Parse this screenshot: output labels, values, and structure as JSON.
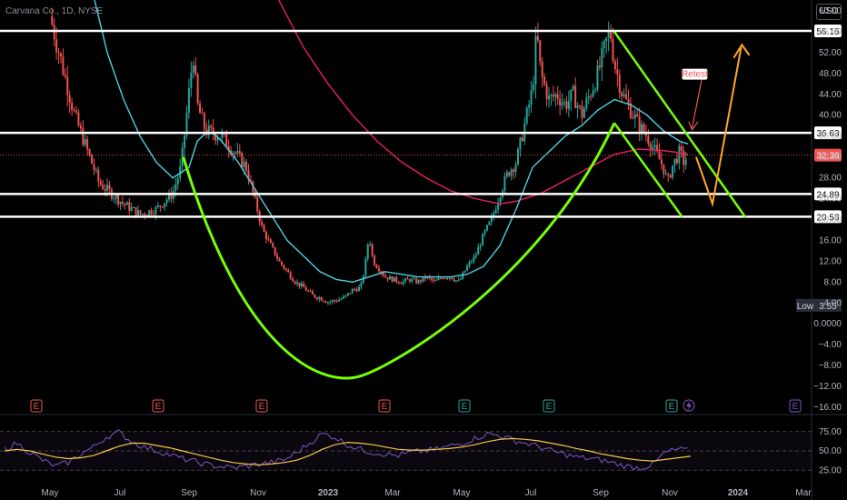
{
  "header": {
    "title": "Carvana Co., 1D, NYSE",
    "currency": "USD"
  },
  "colors": {
    "background": "#000000",
    "up": "#26a69a",
    "down": "#ef5350",
    "hline": "#ffffff",
    "ma_fast": "#4dd0e1",
    "ma_slow": "#e91e63",
    "pattern": "#76ff03",
    "projection": "#ffa726",
    "retest": "#ef5350",
    "rsi": "#7e57c2",
    "rsi_ma": "#f5c542"
  },
  "chart_data": {
    "type": "candlestick",
    "price_axis": {
      "ticks": [
        "60.00",
        "56.00",
        "52.00",
        "48.00",
        "44.00",
        "40.00",
        "36.00",
        "32.00",
        "28.00",
        "24.00",
        "20.00",
        "16.00",
        "12.00",
        "8.00",
        "4.00",
        "0.0000",
        "−4.00",
        "−8.00",
        "−12.00",
        "−16.00"
      ],
      "range": [
        -16,
        60
      ]
    },
    "time_axis": [
      "May",
      "Jul",
      "Sep",
      "Nov",
      "2023",
      "Mar",
      "May",
      "Jul",
      "Sep",
      "Nov",
      "2024",
      "Mar"
    ],
    "horizontal_levels": [
      {
        "value": 56.16,
        "label": "56.16"
      },
      {
        "value": 36.63,
        "label": "36.63"
      },
      {
        "value": 24.89,
        "label": "24.89"
      },
      {
        "value": 20.53,
        "label": "20.53"
      }
    ],
    "current_price": {
      "value": 32.36,
      "label": "32.36"
    },
    "low_marker": {
      "label": "Low",
      "value": "3.55"
    },
    "annotation": "Retest",
    "earnings_markers": [
      {
        "date": "2022-05-05",
        "type": "E",
        "color": "#ef5350"
      },
      {
        "date": "2022-08-04",
        "type": "E",
        "color": "#ef5350"
      },
      {
        "date": "2022-11-03",
        "type": "E",
        "color": "#ef5350"
      },
      {
        "date": "2023-02-23",
        "type": "E",
        "color": "#ef5350"
      },
      {
        "date": "2023-05-04",
        "type": "E",
        "color": "#26a69a"
      },
      {
        "date": "2023-07-19",
        "type": "E",
        "color": "#26a69a"
      },
      {
        "date": "2023-11-01",
        "type": "E",
        "color": "#26a69a"
      },
      {
        "date": "2024-02-22",
        "type": "E",
        "color": "#7e57c2"
      }
    ],
    "price_path": [
      [
        0,
        59
      ],
      [
        3,
        40
      ],
      [
        6,
        27
      ],
      [
        9,
        23
      ],
      [
        11,
        21
      ],
      [
        13,
        22
      ],
      [
        15,
        25
      ],
      [
        16,
        30
      ],
      [
        16.5,
        37
      ],
      [
        17.5,
        52
      ],
      [
        18,
        42
      ],
      [
        19,
        37
      ],
      [
        21,
        36
      ],
      [
        23,
        32
      ],
      [
        24,
        30
      ],
      [
        25,
        24
      ],
      [
        26,
        18
      ],
      [
        27,
        15
      ],
      [
        28,
        12
      ],
      [
        29,
        10
      ],
      [
        30,
        8
      ],
      [
        31,
        7
      ],
      [
        32,
        5.5
      ],
      [
        33,
        5
      ],
      [
        34,
        4.2
      ],
      [
        35,
        4.5
      ],
      [
        36,
        5
      ],
      [
        37,
        6.5
      ],
      [
        38,
        7
      ],
      [
        38.5,
        11
      ],
      [
        39,
        17
      ],
      [
        39.5,
        12
      ],
      [
        40,
        11
      ],
      [
        41,
        9
      ],
      [
        42,
        8.5
      ],
      [
        43,
        8
      ],
      [
        44,
        8.5
      ],
      [
        45,
        8
      ],
      [
        46,
        9
      ],
      [
        47,
        8
      ],
      [
        48,
        9
      ],
      [
        49,
        9
      ],
      [
        50,
        8
      ],
      [
        51,
        11
      ],
      [
        52,
        13
      ],
      [
        53,
        17
      ],
      [
        54,
        20
      ],
      [
        55,
        25
      ],
      [
        56,
        29
      ],
      [
        57,
        31
      ],
      [
        58,
        38
      ],
      [
        59,
        45
      ],
      [
        59.5,
        56
      ],
      [
        60,
        48
      ],
      [
        61,
        43
      ],
      [
        62,
        44
      ],
      [
        63,
        42
      ],
      [
        64,
        44
      ],
      [
        65,
        40
      ],
      [
        66,
        44
      ],
      [
        67,
        48
      ],
      [
        68,
        54
      ],
      [
        68.5,
        56
      ],
      [
        69,
        50
      ],
      [
        70,
        44
      ],
      [
        71,
        41
      ],
      [
        72,
        38
      ],
      [
        73,
        36
      ],
      [
        74,
        33
      ],
      [
        75,
        30
      ],
      [
        75.5,
        27
      ],
      [
        76,
        30
      ],
      [
        77,
        33
      ],
      [
        77.5,
        31
      ],
      [
        78,
        32.4
      ]
    ],
    "ma_fast_path": [
      [
        3,
        85
      ],
      [
        5,
        65
      ],
      [
        7,
        52
      ],
      [
        9,
        43
      ],
      [
        11,
        36
      ],
      [
        13,
        31
      ],
      [
        15,
        28
      ],
      [
        17,
        30
      ],
      [
        18,
        35
      ],
      [
        19,
        36.5
      ],
      [
        20,
        36.5
      ],
      [
        21,
        35
      ],
      [
        23,
        31
      ],
      [
        25,
        26
      ],
      [
        27,
        21
      ],
      [
        29,
        16
      ],
      [
        31,
        13
      ],
      [
        33,
        10
      ],
      [
        35,
        8.5
      ],
      [
        37,
        8
      ],
      [
        39,
        9
      ],
      [
        41,
        10
      ],
      [
        43,
        9.5
      ],
      [
        45,
        9
      ],
      [
        47,
        9
      ],
      [
        49,
        9
      ],
      [
        51,
        9.5
      ],
      [
        53,
        11
      ],
      [
        55,
        15
      ],
      [
        57,
        22
      ],
      [
        59,
        30
      ],
      [
        61,
        33
      ],
      [
        63,
        36
      ],
      [
        65,
        38
      ],
      [
        67,
        41
      ],
      [
        69,
        43
      ],
      [
        71,
        42
      ],
      [
        73,
        40
      ],
      [
        75,
        37
      ],
      [
        77,
        35
      ],
      [
        78,
        34.5
      ]
    ],
    "ma_slow_path": [
      [
        20,
        100
      ],
      [
        22,
        88
      ],
      [
        25,
        73
      ],
      [
        28,
        62
      ],
      [
        31,
        53
      ],
      [
        34,
        46
      ],
      [
        37,
        40
      ],
      [
        40,
        35
      ],
      [
        43,
        31
      ],
      [
        46,
        28
      ],
      [
        49,
        25.5
      ],
      [
        52,
        24
      ],
      [
        55,
        23
      ],
      [
        57,
        23.5
      ],
      [
        60,
        25
      ],
      [
        63,
        27.5
      ],
      [
        66,
        30
      ],
      [
        69,
        32.5
      ],
      [
        72,
        33.5
      ],
      [
        75,
        33.2
      ],
      [
        77,
        32.8
      ],
      [
        78,
        32.5
      ]
    ],
    "rsi": {
      "levels": [
        "75.00",
        "50.00",
        "25.00"
      ],
      "range": [
        10,
        90
      ],
      "values": [
        52,
        60,
        48,
        38,
        30,
        35,
        46,
        55,
        68,
        74,
        62,
        55,
        50,
        45,
        40,
        36,
        32,
        30,
        28,
        30,
        33,
        35,
        38,
        48,
        60,
        72,
        68,
        58,
        52,
        48,
        46,
        44,
        48,
        50,
        52,
        56,
        60,
        66,
        72,
        70,
        64,
        60,
        56,
        50,
        46,
        42,
        40,
        38,
        34,
        30,
        28,
        32,
        48,
        52,
        50
      ],
      "ma": [
        50,
        52,
        50,
        46,
        42,
        40,
        41,
        44,
        50,
        56,
        60,
        60,
        57,
        54,
        50,
        46,
        42,
        38,
        35,
        33,
        32,
        33,
        35,
        38,
        44,
        52,
        58,
        61,
        60,
        58,
        55,
        52,
        51,
        51,
        52,
        53,
        55,
        58,
        62,
        65,
        66,
        65,
        63,
        60,
        57,
        53,
        50,
        46,
        43,
        40,
        38,
        37,
        39,
        41,
        43
      ]
    }
  }
}
